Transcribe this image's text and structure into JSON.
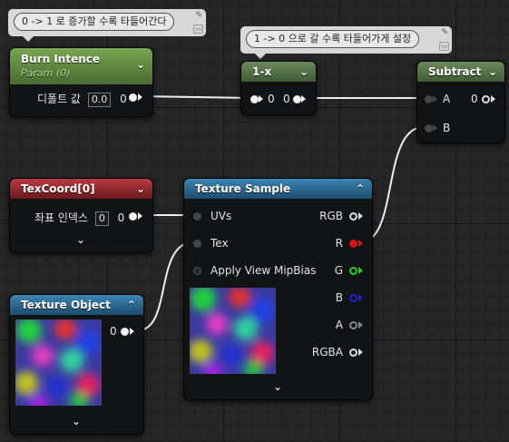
{
  "comments": {
    "burn": "0 -> 1 로 증가할 수록 타들어간다",
    "one_minus": "1 -> 0 으로 갈 수록 타들어가게 설정"
  },
  "burn_node": {
    "title": "Burn Intence",
    "subtitle": "Param (0)",
    "default_label": "디폴트 값",
    "default_value": "0.0",
    "out_value": "0"
  },
  "one_minus_node": {
    "title": "1-x",
    "in_value": "0",
    "out_value": "0"
  },
  "subtract_node": {
    "title": "Subtract",
    "input_a": "A",
    "input_b": "B",
    "a_value": "0"
  },
  "texcoord_node": {
    "title": "TexCoord[0]",
    "index_label": "좌표 인덱스",
    "index_value": "0",
    "out_value": "0"
  },
  "texture_sample_node": {
    "title": "Texture Sample",
    "inputs": {
      "uvs": "UVs",
      "tex": "Tex",
      "mip": "Apply View MipBias"
    },
    "outputs": {
      "rgb": "RGB",
      "r": "R",
      "g": "G",
      "b": "B",
      "a": "A",
      "rgba": "RGBA"
    }
  },
  "texture_object_node": {
    "title": "Texture Object",
    "out_value": "0"
  },
  "icons": {
    "collapse": "chevron-down-icon",
    "collapse_up": "chevron-up-icon",
    "pin": "pin-icon"
  },
  "colors": {
    "param_header": "#78a650",
    "math_header": "#6b8a5c",
    "coord_header": "#b83a40",
    "texture_header": "#3c84b0",
    "r_pin": "#e01010",
    "g_pin": "#20d020",
    "b_pin": "#2020e0"
  }
}
